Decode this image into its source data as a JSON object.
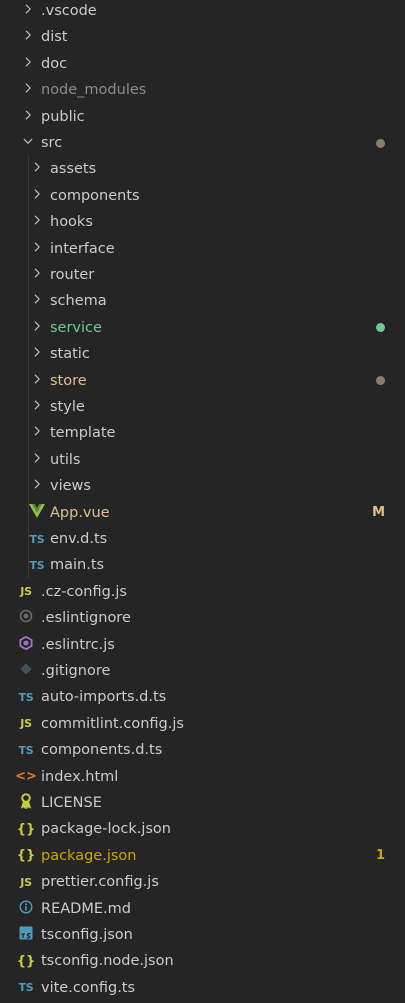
{
  "colors": {
    "background": "#252526",
    "text": "#cccccc",
    "ignored": "#8c8c8c",
    "untracked_green": "#73c991",
    "modified_yellow": "#e2c08d",
    "error_yellow": "#cca700",
    "dot_gray": "#8b7d6b"
  },
  "tree": [
    {
      "name": ".vscode",
      "kind": "folder",
      "depth": 0,
      "icon": "chevron-right-icon"
    },
    {
      "name": "dist",
      "kind": "folder",
      "depth": 0,
      "icon": "chevron-right-icon"
    },
    {
      "name": "doc",
      "kind": "folder",
      "depth": 0,
      "icon": "chevron-right-icon"
    },
    {
      "name": "node_modules",
      "kind": "folder",
      "depth": 0,
      "icon": "chevron-right-icon",
      "status": "ignored"
    },
    {
      "name": "public",
      "kind": "folder",
      "depth": 0,
      "icon": "chevron-right-icon"
    },
    {
      "name": "src",
      "kind": "folder",
      "depth": 0,
      "icon": "chevron-down-icon",
      "expanded": true,
      "decoration": "dot",
      "dot_color": "#8b7d6b"
    },
    {
      "name": "assets",
      "kind": "folder",
      "depth": 1,
      "icon": "chevron-right-icon"
    },
    {
      "name": "components",
      "kind": "folder",
      "depth": 1,
      "icon": "chevron-right-icon"
    },
    {
      "name": "hooks",
      "kind": "folder",
      "depth": 1,
      "icon": "chevron-right-icon"
    },
    {
      "name": "interface",
      "kind": "folder",
      "depth": 1,
      "icon": "chevron-right-icon"
    },
    {
      "name": "router",
      "kind": "folder",
      "depth": 1,
      "icon": "chevron-right-icon"
    },
    {
      "name": "schema",
      "kind": "folder",
      "depth": 1,
      "icon": "chevron-right-icon"
    },
    {
      "name": "service",
      "kind": "folder",
      "depth": 1,
      "icon": "chevron-right-icon",
      "status": "untracked",
      "decoration": "dot",
      "dot_color": "#73c991"
    },
    {
      "name": "static",
      "kind": "folder",
      "depth": 1,
      "icon": "chevron-right-icon"
    },
    {
      "name": "store",
      "kind": "folder",
      "depth": 1,
      "icon": "chevron-right-icon",
      "status": "modified",
      "decoration": "dot",
      "dot_color": "#8b7d6b"
    },
    {
      "name": "style",
      "kind": "folder",
      "depth": 1,
      "icon": "chevron-right-icon"
    },
    {
      "name": "template",
      "kind": "folder",
      "depth": 1,
      "icon": "chevron-right-icon"
    },
    {
      "name": "utils",
      "kind": "folder",
      "depth": 1,
      "icon": "chevron-right-icon"
    },
    {
      "name": "views",
      "kind": "folder",
      "depth": 1,
      "icon": "chevron-right-icon"
    },
    {
      "name": "App.vue",
      "kind": "file",
      "depth": 1,
      "icon": "vue-icon",
      "status": "modified",
      "decoration": "M"
    },
    {
      "name": "env.d.ts",
      "kind": "file",
      "depth": 1,
      "icon": "typescript-icon"
    },
    {
      "name": "main.ts",
      "kind": "file",
      "depth": 1,
      "icon": "typescript-icon"
    },
    {
      "name": ".cz-config.js",
      "kind": "file",
      "depth": 0,
      "icon": "javascript-icon"
    },
    {
      "name": ".eslintignore",
      "kind": "file",
      "depth": 0,
      "icon": "eslint-ignore-icon"
    },
    {
      "name": ".eslintrc.js",
      "kind": "file",
      "depth": 0,
      "icon": "eslint-icon"
    },
    {
      "name": ".gitignore",
      "kind": "file",
      "depth": 0,
      "icon": "git-icon"
    },
    {
      "name": "auto-imports.d.ts",
      "kind": "file",
      "depth": 0,
      "icon": "typescript-icon"
    },
    {
      "name": "commitlint.config.js",
      "kind": "file",
      "depth": 0,
      "icon": "javascript-icon"
    },
    {
      "name": "components.d.ts",
      "kind": "file",
      "depth": 0,
      "icon": "typescript-icon"
    },
    {
      "name": "index.html",
      "kind": "file",
      "depth": 0,
      "icon": "html-icon"
    },
    {
      "name": "LICENSE",
      "kind": "file",
      "depth": 0,
      "icon": "license-icon"
    },
    {
      "name": "package-lock.json",
      "kind": "file",
      "depth": 0,
      "icon": "json-icon"
    },
    {
      "name": "package.json",
      "kind": "file",
      "depth": 0,
      "icon": "json-icon",
      "status": "error",
      "decoration": "1"
    },
    {
      "name": "prettier.config.js",
      "kind": "file",
      "depth": 0,
      "icon": "javascript-icon"
    },
    {
      "name": "README.md",
      "kind": "file",
      "depth": 0,
      "icon": "info-icon"
    },
    {
      "name": "tsconfig.json",
      "kind": "file",
      "depth": 0,
      "icon": "tsconfig-icon"
    },
    {
      "name": "tsconfig.node.json",
      "kind": "file",
      "depth": 0,
      "icon": "json-icon"
    },
    {
      "name": "vite.config.ts",
      "kind": "file",
      "depth": 0,
      "icon": "typescript-icon"
    }
  ]
}
